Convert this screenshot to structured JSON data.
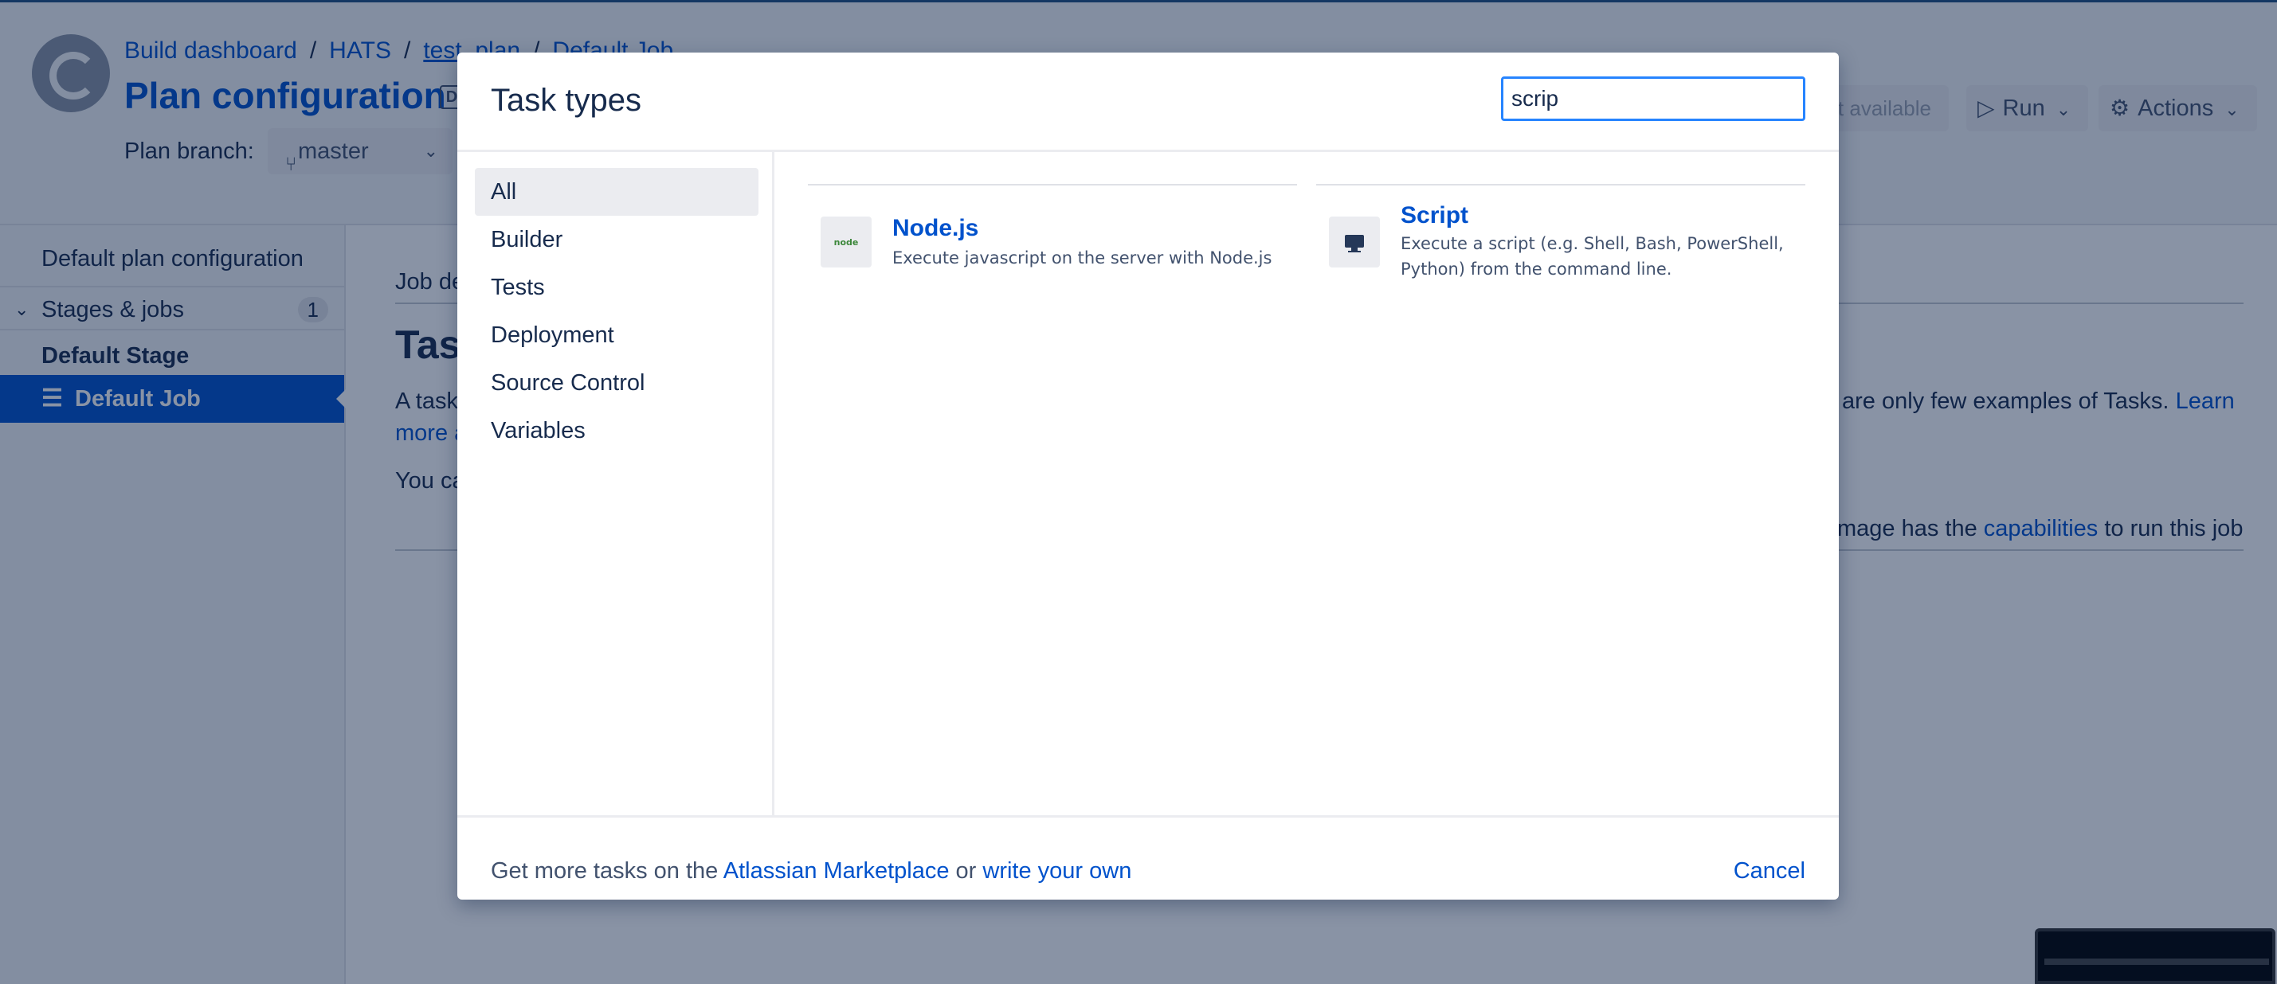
{
  "background": {
    "breadcrumb": [
      "Build dashboard",
      "HATS",
      "test_plan",
      "Default Job"
    ],
    "page_title": "Plan configuration",
    "title_badge": "D",
    "plan_branch_label": "Plan branch:",
    "branch": "master",
    "not_available_label": "t available",
    "run_label": "Run",
    "actions_label": "Actions",
    "sidebar": {
      "default_config": "Default plan configuration",
      "stages_label": "Stages & jobs",
      "stages_count": "1",
      "stage": "Default Stage",
      "job": "Default Job"
    },
    "main": {
      "job_details_tab": "Job de",
      "tasks_heading": "Task",
      "para1_start": "A task",
      "para1_end": "are only few examples of Tasks.",
      "learn": "Learn",
      "more": "more a",
      "para2_start": "You ca",
      "para3_pre": "mage has the",
      "capabilities": "capabilities",
      "para3_post": "to run this job"
    }
  },
  "modal": {
    "title": "Task types",
    "search_value": "scrip",
    "categories": [
      "All",
      "Builder",
      "Tests",
      "Deployment",
      "Source Control",
      "Variables"
    ],
    "tasks": [
      {
        "name": "Node.js",
        "icon": "nodejs-logo-icon",
        "icon_text": "node",
        "description": "Execute javascript on the server with Node.js"
      },
      {
        "name": "Script",
        "icon": "terminal-monitor-icon",
        "description_line1": "Execute a script (e.g. Shell, Bash, PowerShell,",
        "description_line2": "Python) from the command line."
      }
    ],
    "footer": {
      "prefix": "Get more tasks on the",
      "marketplace": "Atlassian Marketplace",
      "or": "or",
      "write_own": "write your own",
      "cancel": "Cancel"
    }
  },
  "colors": {
    "accent": "#0052cc",
    "overlay": "#091e42",
    "focus": "#2684ff"
  }
}
